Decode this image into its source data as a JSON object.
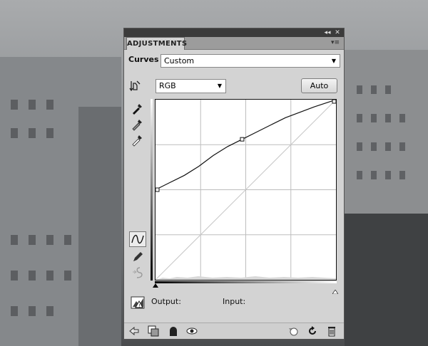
{
  "panel": {
    "tab_label": "ADJUSTMENTS",
    "preset_label": "Curves",
    "preset_value": "Custom",
    "channel_value": "RGB",
    "auto_label": "Auto",
    "output_label": "Output:",
    "input_label": "Input:"
  },
  "curve": {
    "points": [
      [
        0,
        50
      ],
      [
        48,
        78
      ],
      [
        100,
        100
      ]
    ],
    "path_samples": [
      [
        0,
        50
      ],
      [
        8,
        54
      ],
      [
        16,
        58
      ],
      [
        24,
        63
      ],
      [
        32,
        69
      ],
      [
        40,
        74
      ],
      [
        48,
        78
      ],
      [
        56,
        82
      ],
      [
        64,
        86
      ],
      [
        72,
        90
      ],
      [
        80,
        93
      ],
      [
        88,
        96
      ],
      [
        100,
        100
      ]
    ]
  },
  "icons": {
    "titlebar": [
      "collapse-icon",
      "close-icon"
    ],
    "tools": [
      "on-image-adjust-icon",
      "black-point-eyedropper-icon",
      "gray-point-eyedropper-icon",
      "white-point-eyedropper-icon",
      "curve-points-icon",
      "pencil-icon",
      "smooth-icon",
      "clipping-warning-icon"
    ],
    "footer_left": [
      "back-arrow-icon",
      "clip-to-layer-icon",
      "mask-icon",
      "visibility-eye-icon"
    ],
    "footer_right": [
      "reset-previous-icon",
      "reset-icon",
      "trash-icon"
    ]
  }
}
